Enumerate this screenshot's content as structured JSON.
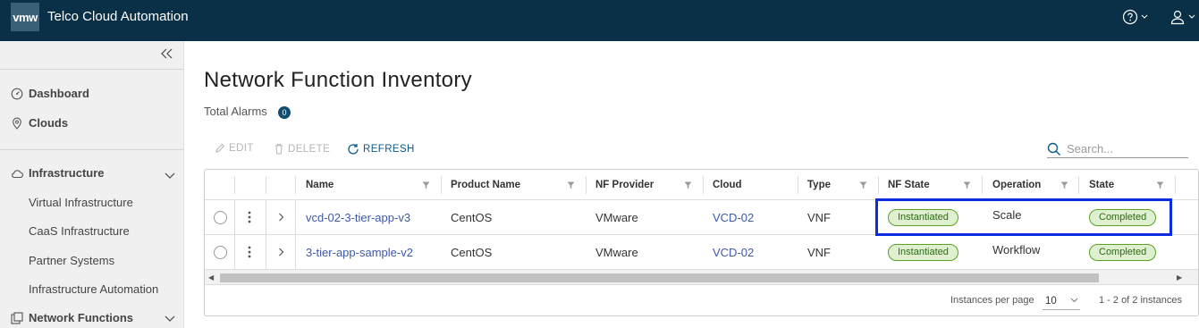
{
  "header": {
    "logo_text": "vmw",
    "app_title": "Telco Cloud Automation",
    "help_icon": "help-circle-icon",
    "user_icon": "user-icon"
  },
  "sidebar": {
    "collapse_icon": "double-chevron-left-icon",
    "items": [
      {
        "label": "Dashboard",
        "icon": "dashboard-icon"
      },
      {
        "label": "Clouds",
        "icon": "location-pin-icon"
      },
      {
        "label": "Infrastructure",
        "icon": "cloud-icon"
      },
      {
        "label": "Network Functions",
        "icon": "network-functions-icon"
      }
    ],
    "infra_sub": [
      "Virtual Infrastructure",
      "CaaS Infrastructure",
      "Partner Systems",
      "Infrastructure Automation"
    ]
  },
  "main": {
    "title": "Network Function Inventory",
    "alarms_label": "Total Alarms",
    "alarms_count": "0",
    "toolbar": {
      "edit": "EDIT",
      "delete": "DELETE",
      "refresh": "REFRESH"
    },
    "search_placeholder": "Search...",
    "columns": [
      "Name",
      "Product Name",
      "NF Provider",
      "Cloud",
      "Type",
      "NF State",
      "Operation",
      "State"
    ],
    "rows": [
      {
        "name": "vcd-02-3-tier-app-v3",
        "product": "CentOS",
        "provider": "VMware",
        "cloud": "VCD-02",
        "type": "VNF",
        "nf_state": "Instantiated",
        "operation": "Scale",
        "state": "Completed"
      },
      {
        "name": "3-tier-app-sample-v2",
        "product": "CentOS",
        "provider": "VMware",
        "cloud": "VCD-02",
        "type": "VNF",
        "nf_state": "Instantiated",
        "operation": "Workflow",
        "state": "Completed"
      }
    ],
    "footer": {
      "per_page_label": "Instances per page",
      "per_page_value": "10",
      "pager_text": "1 - 2 of 2 instances"
    }
  },
  "colors": {
    "header_bg": "#0a3047",
    "sidebar_bg": "#f0f0f0",
    "link": "#3e59a8",
    "accent": "#0e5a8a",
    "success_badge_bg": "#dff0d0",
    "success_badge_border": "#5aa220",
    "highlight_box": "#0b2ce0"
  }
}
